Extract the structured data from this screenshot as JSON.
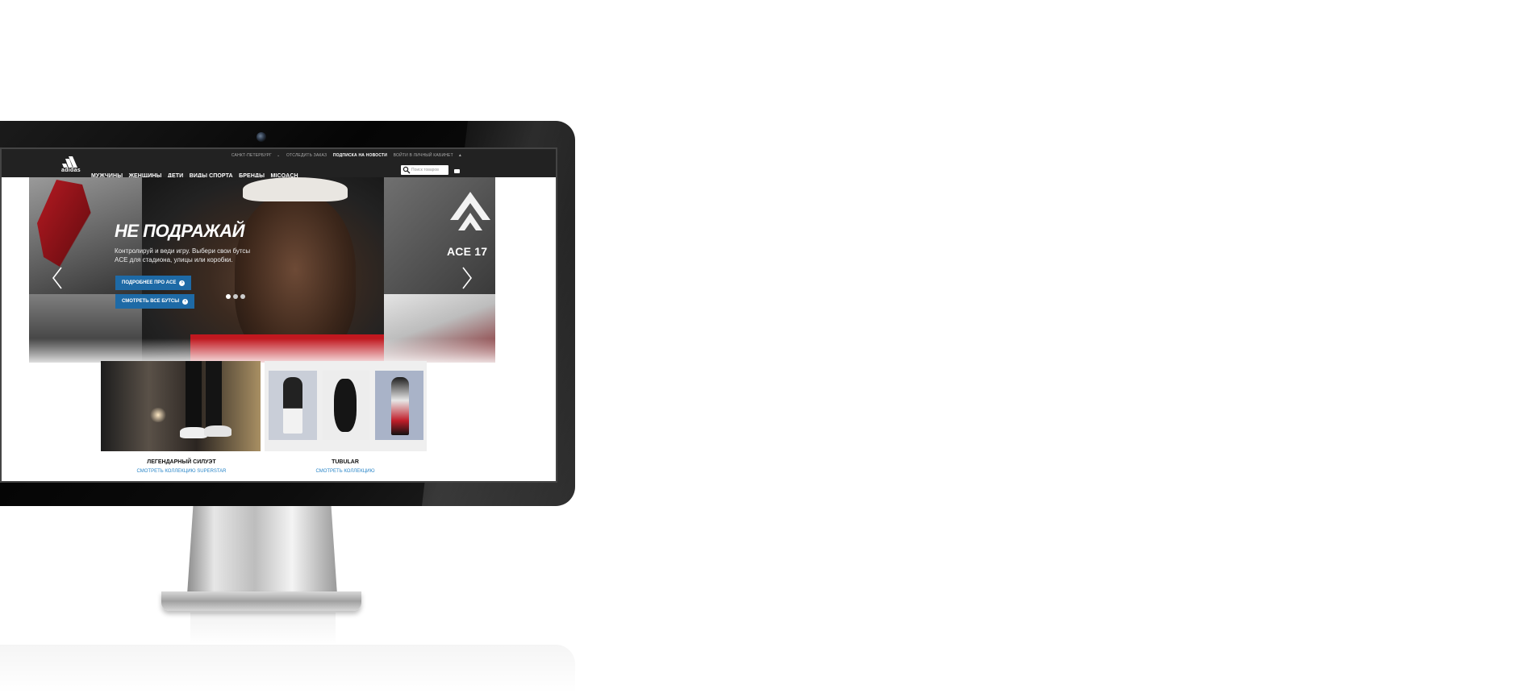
{
  "header": {
    "utility_links": [
      "САНКТ-ПЕТЕРБУРГ",
      "ОТСЛЕДИТЬ ЗАКАЗ",
      "ПОДПИСКА НА НОВОСТИ",
      "ВОЙТИ В ЛИЧНЫЙ КАБИНЕТ"
    ],
    "logo_text": "adidas",
    "nav": [
      "МУЖЧИНЫ",
      "ЖЕНЩИНЫ",
      "ДЕТИ",
      "ВИДЫ СПОРТА",
      "БРЕНДЫ",
      "MICOACH"
    ],
    "search_placeholder": "Поиск товаров"
  },
  "hero": {
    "headline": "НЕ ПОДРАЖАЙ",
    "subtext": "Контролируй и веди игру. Выбери свои бутсы ACE для стадиона, улицы или коробки.",
    "button_primary": "ПОДРОБНЕЕ ПРО ACE",
    "button_secondary": "СМОТРЕТЬ ВСЕ БУТСЫ",
    "badge": "ACE 17",
    "slides_count": 3,
    "active_slide": 1
  },
  "tiles": [
    {
      "title": "ЛЕГЕНДАРНЫЙ СИЛУЭТ",
      "link": "СМОТРЕТЬ КОЛЛЕКЦИЮ SUPERSTAR"
    },
    {
      "title": "TUBULAR",
      "link": "СМОТРЕТЬ КОЛЛЕКЦИЮ"
    }
  ],
  "colors": {
    "topbar": "#222222",
    "accent_button": "#1e6aa6",
    "link": "#2a86c8"
  }
}
